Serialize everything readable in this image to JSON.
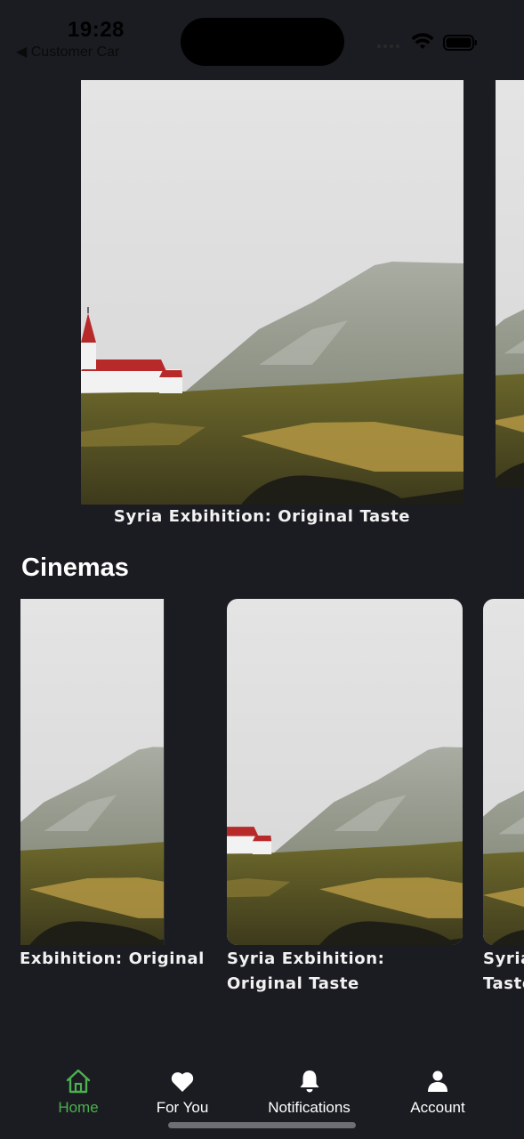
{
  "status_bar": {
    "time": "19:28",
    "back_label": "◀ Customer Car"
  },
  "carousel": {
    "caption": "Syria Exbihition: Original Taste"
  },
  "cinemas": {
    "title": "Cinemas",
    "cards": [
      {
        "caption": "Exbihition: Original"
      },
      {
        "caption": "Syria Exbihition: Original Taste"
      },
      {
        "caption": "Syria Taste"
      }
    ]
  },
  "tab_bar": {
    "items": [
      {
        "label": "Home",
        "icon": "home-icon",
        "active": true
      },
      {
        "label": "For You",
        "icon": "heart-icon",
        "active": false
      },
      {
        "label": "Notifications",
        "icon": "bell-icon",
        "active": false
      },
      {
        "label": "Account",
        "icon": "person-icon",
        "active": false
      }
    ]
  },
  "colors": {
    "background": "#1b1c21",
    "accent": "#4caf50",
    "text": "#ffffff"
  }
}
